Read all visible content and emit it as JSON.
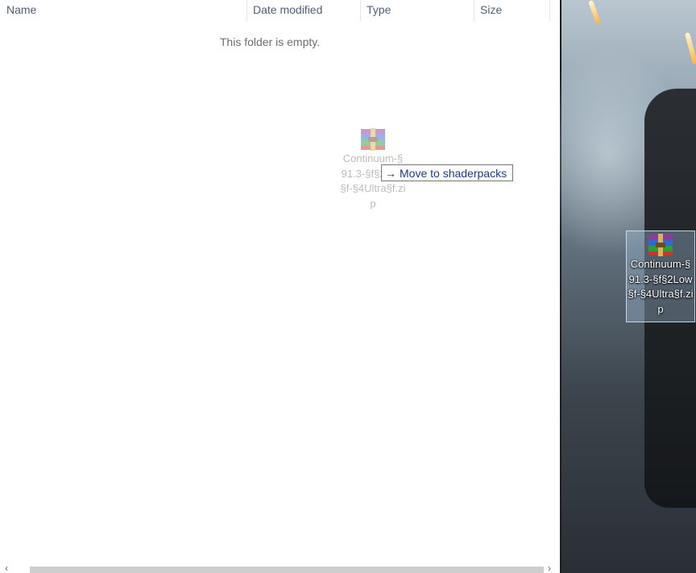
{
  "columns": {
    "name": "Name",
    "date_modified": "Date modified",
    "type": "Type",
    "size": "Size"
  },
  "empty_message": "This folder is empty.",
  "dragged_file": {
    "label_lines": [
      "Continuum-§",
      "91.3-§f§2Low",
      "§f-§4Ultra§f.zi",
      "p"
    ],
    "icon": "winrar-archive-icon"
  },
  "drop_tooltip": {
    "arrow": "→",
    "text": "Move to shaderpacks"
  },
  "desktop_file": {
    "label_lines": [
      "Continuum-§",
      "91.3-§f§2Low",
      "§f-§4Ultra§f.zi",
      "p"
    ],
    "icon": "winrar-archive-icon"
  },
  "scrollbar": {
    "left_arrow": "‹",
    "right_arrow": "›"
  },
  "colors": {
    "header_text": "#4c607a",
    "tooltip_text": "#1a3d8a",
    "selection": "#aac8e6"
  }
}
